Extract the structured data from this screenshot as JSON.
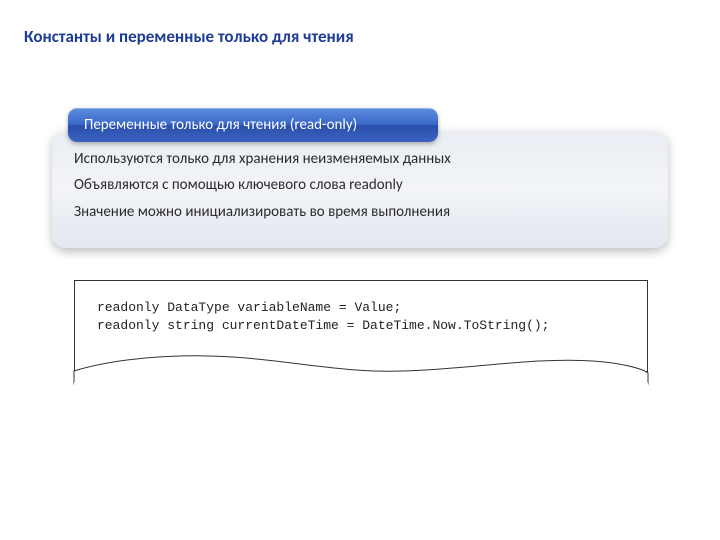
{
  "title": "Константы и переменные только для чтения",
  "header": {
    "label": "Переменные только для чтения (read-only)"
  },
  "info": {
    "line1": "Используются только для хранения неизменяемых данных",
    "line2": "Объявляются с помощью ключевого слова readonly",
    "line3": "Значение можно  инициализировать во время выполнения"
  },
  "code": {
    "text": "readonly DataType variableName = Value;\nreadonly string currentDateTime = DateTime.Now.ToString();"
  }
}
